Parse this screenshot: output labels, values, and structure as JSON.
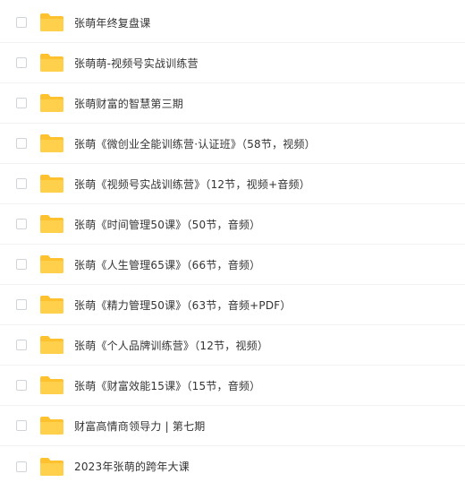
{
  "folder_icon_color": "#FFD04B",
  "folder_tab_color": "#FFC12E",
  "items": [
    {
      "name": "张萌年终复盘课",
      "checked": false,
      "icon": "folder-icon"
    },
    {
      "name": "张萌萌-视频号实战训练营",
      "checked": false,
      "icon": "folder-icon"
    },
    {
      "name": "张萌财富的智慧第三期",
      "checked": false,
      "icon": "folder-icon"
    },
    {
      "name": "张萌《微创业全能训练营·认证班》（58节，视频）",
      "checked": false,
      "icon": "folder-icon"
    },
    {
      "name": "张萌《视频号实战训练营》（12节，视频+音频）",
      "checked": false,
      "icon": "folder-icon"
    },
    {
      "name": "张萌《时间管理50课》（50节，音频）",
      "checked": false,
      "icon": "folder-icon"
    },
    {
      "name": "张萌《人生管理65课》（66节，音频）",
      "checked": false,
      "icon": "folder-icon"
    },
    {
      "name": "张萌《精力管理50课》（63节，音频+PDF）",
      "checked": false,
      "icon": "folder-icon"
    },
    {
      "name": "张萌《个人品牌训练营》（12节，视频）",
      "checked": false,
      "icon": "folder-icon"
    },
    {
      "name": "张萌《财富效能15课》（15节，音频）",
      "checked": false,
      "icon": "folder-icon"
    },
    {
      "name": "财富高情商领导力 | 第七期",
      "checked": false,
      "icon": "folder-icon"
    },
    {
      "name": "2023年张萌的跨年大课",
      "checked": false,
      "icon": "folder-icon"
    }
  ]
}
